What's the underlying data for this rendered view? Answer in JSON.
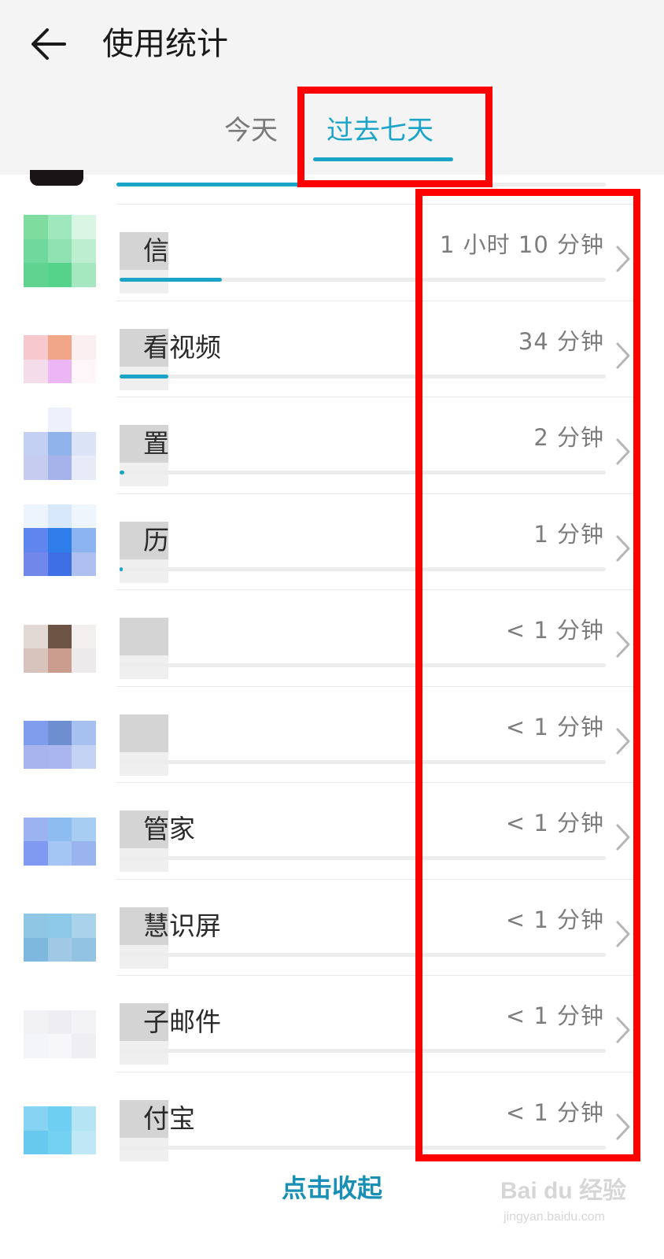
{
  "header": {
    "title": "使用统计",
    "tabs": [
      "今天",
      "过去七天"
    ],
    "active_tab": 1
  },
  "apps": [
    {
      "name_visible": "信",
      "duration": "1 小时 10 分钟",
      "usage_fraction": 0.21,
      "icon_colors": [
        "#7edc9f",
        "#9fe7bd",
        "#d9f5e4",
        "#6fd89a",
        "#8fe1b2",
        "#bdeed0",
        "#5fd38f",
        "#56d38a",
        "#a5e8c0"
      ]
    },
    {
      "name_visible": "看视频",
      "duration": "34 分钟",
      "usage_fraction": 0.1,
      "icon_colors": [
        "#ffffff",
        "#ffffff",
        "#ffffff",
        "#f7c9cf",
        "#f2a688",
        "#fbeff2",
        "#f5dcea",
        "#ecb6f5",
        "#fff6fa"
      ]
    },
    {
      "name_visible": "置",
      "duration": "2 分钟",
      "usage_fraction": 0.01,
      "icon_colors": [
        "#ffffff",
        "#eef1fb",
        "#ffffff",
        "#c3d0f3",
        "#8fb3ea",
        "#dbe4f7",
        "#c6cbf0",
        "#a5b3ea",
        "#e7ebf8"
      ]
    },
    {
      "name_visible": "历",
      "duration": "1 分钟",
      "usage_fraction": 0.005,
      "icon_colors": [
        "#eef4fd",
        "#d8e8fb",
        "#eef5fd",
        "#5f86ee",
        "#2f7de8",
        "#8cb4f1",
        "#7287ea",
        "#3f6fe4",
        "#aec0ef"
      ]
    },
    {
      "name_visible": "",
      "duration": "< 1 分钟",
      "usage_fraction": 0,
      "icon_colors": [
        "#ffffff",
        "#ffffff",
        "#ffffff",
        "#e2d8d4",
        "#6e5444",
        "#f3efee",
        "#d9c4bd",
        "#c99c8e",
        "#eceaea"
      ]
    },
    {
      "name_visible": "",
      "duration": "< 1 分钟",
      "usage_fraction": 0,
      "icon_colors": [
        "#ffffff",
        "#ffffff",
        "#ffffff",
        "#7f9dec",
        "#6d8fd0",
        "#a6c1ef",
        "#a8b4ee",
        "#aab6f0",
        "#c4d3f3"
      ]
    },
    {
      "name_visible": "管家",
      "duration": "< 1 分钟",
      "usage_fraction": 0,
      "icon_colors": [
        "#ffffff",
        "#ffffff",
        "#ffffff",
        "#9cb3f1",
        "#8cbcf0",
        "#a8cdf3",
        "#7f9af0",
        "#a4c6f4",
        "#9ab4f0"
      ]
    },
    {
      "name_visible": "慧识屏",
      "duration": "< 1 分钟",
      "usage_fraction": 0,
      "icon_colors": [
        "#ffffff",
        "#ffffff",
        "#ffffff",
        "#8ec6e3",
        "#8cc8e8",
        "#a8d3ea",
        "#7fb8de",
        "#9fc9e4",
        "#93c3e2"
      ]
    },
    {
      "name_visible": "子邮件",
      "duration": "< 1 分钟",
      "usage_fraction": 0,
      "icon_colors": [
        "#ffffff",
        "#ffffff",
        "#ffffff",
        "#f2f2f4",
        "#eeeef2",
        "#f3f3f5",
        "#f4f5f8",
        "#f7f7fa",
        "#efeff3"
      ]
    },
    {
      "name_visible": "付宝",
      "duration": "< 1 分钟",
      "usage_fraction": 0,
      "icon_colors": [
        "#ffffff",
        "#ffffff",
        "#ffffff",
        "#86d3f3",
        "#6ecff2",
        "#b5e4f5",
        "#68c9ef",
        "#74d1f2",
        "#c0e7f6"
      ]
    }
  ],
  "footer": {
    "collapse_label": "点击收起"
  },
  "watermark": {
    "logo_text": "Bai du 经验",
    "url": "jingyan.baidu.com"
  },
  "colors": {
    "accent": "#1aa5c8",
    "annotation": "#ff0000"
  }
}
